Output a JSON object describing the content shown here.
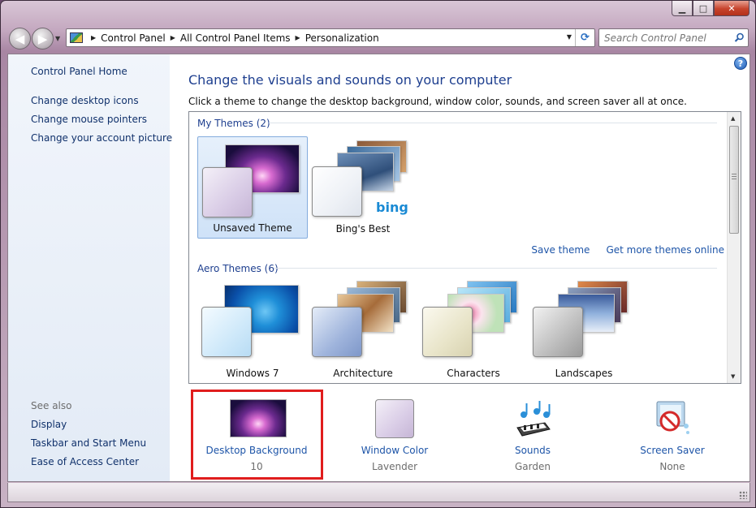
{
  "window": {
    "caption": {
      "minimize": "▁",
      "maximize": "□",
      "close": "✕"
    }
  },
  "nav": {
    "back_glyph": "◀",
    "forward_glyph": "▶",
    "breadcrumb": [
      "Control Panel",
      "All Control Panel Items",
      "Personalization"
    ],
    "refresh_glyph": "⟳",
    "search_placeholder": "Search Control Panel"
  },
  "sidebar": {
    "home": "Control Panel Home",
    "links": [
      "Change desktop icons",
      "Change mouse pointers",
      "Change your account picture"
    ],
    "see_also_label": "See also",
    "see_also": [
      "Display",
      "Taskbar and Start Menu",
      "Ease of Access Center"
    ]
  },
  "main": {
    "help_glyph": "?",
    "title": "Change the visuals and sounds on your computer",
    "description": "Click a theme to change the desktop background, window color, sounds, and screen saver all at once.",
    "my_themes_header": "My Themes (2)",
    "my_themes": [
      {
        "label": "Unsaved Theme",
        "selected": true
      },
      {
        "label": "Bing's Best",
        "selected": false,
        "logo": "bing"
      }
    ],
    "actions": {
      "save": "Save theme",
      "get_more": "Get more themes online"
    },
    "aero_themes_header": "Aero Themes (6)",
    "aero_themes": [
      {
        "label": "Windows 7"
      },
      {
        "label": "Architecture"
      },
      {
        "label": "Characters"
      },
      {
        "label": "Landscapes"
      }
    ]
  },
  "settings": [
    {
      "title": "Desktop Background",
      "value": "10",
      "icon": "desktop-background-icon",
      "highlighted": true
    },
    {
      "title": "Window Color",
      "value": "Lavender",
      "icon": "window-color-icon"
    },
    {
      "title": "Sounds",
      "value": "Garden",
      "icon": "sounds-icon"
    },
    {
      "title": "Screen Saver",
      "value": "None",
      "icon": "screen-saver-icon"
    }
  ],
  "colors": {
    "link_blue": "#1e55a8",
    "title_blue": "#1e3f8f",
    "highlight_red": "#e01d1d",
    "selected_bg": "#cfe2f8"
  }
}
